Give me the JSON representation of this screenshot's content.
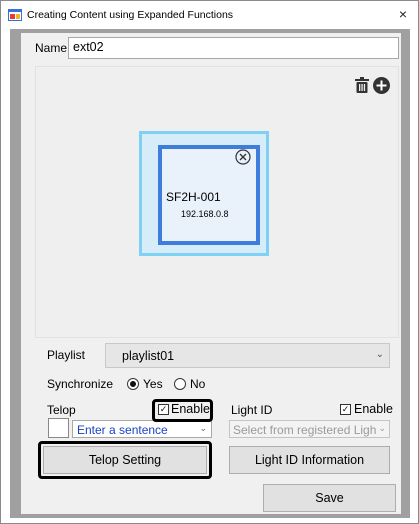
{
  "window": {
    "title": "Creating Content using Expanded Functions",
    "close_symbol": "×",
    "app_icon": "app-window-icon"
  },
  "form": {
    "name_label": "Name",
    "name_value": "ext02"
  },
  "canvas": {
    "toolbar": [
      {
        "icon": "trash-icon"
      },
      {
        "icon": "plus-circle-icon"
      }
    ],
    "device": {
      "name": "SF2H-001",
      "ip": "192.168.0.8",
      "remove_icon": "close-circle-icon"
    }
  },
  "playlist": {
    "label": "Playlist",
    "value": "playlist01"
  },
  "synchronize": {
    "label": "Synchronize",
    "options": [
      {
        "label": "Yes",
        "selected": true
      },
      {
        "label": "No",
        "selected": false
      }
    ]
  },
  "telop": {
    "label": "Telop",
    "enable_label": "Enable",
    "enable_checked": true,
    "sentence_value": "Enter a sentence",
    "setting_button": "Telop Setting"
  },
  "light_id": {
    "label": "Light ID",
    "enable_label": "Enable",
    "enable_checked": true,
    "select_placeholder": "Select from registered Ligh",
    "info_button": "Light ID Information"
  },
  "save_button": "Save",
  "colors": {
    "device_outer_border": "#7fd0f5",
    "device_inner_border": "#3e7ddb",
    "sentence_text": "#1c41c4",
    "highlight": "#000000"
  }
}
